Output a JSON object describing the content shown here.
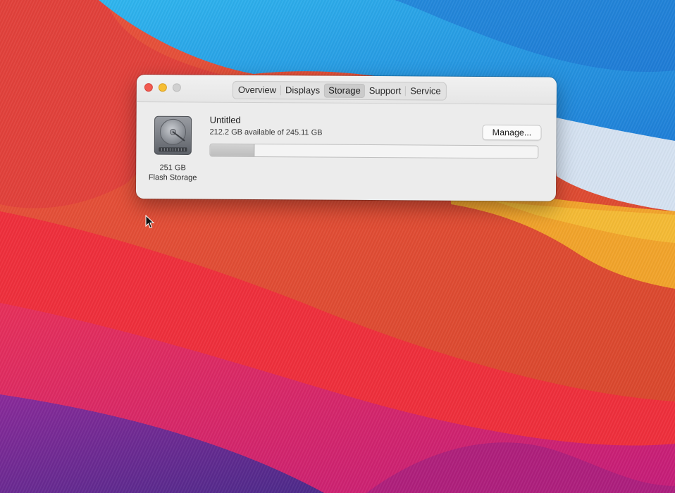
{
  "window": {
    "tabs": [
      {
        "label": "Overview",
        "active": false
      },
      {
        "label": "Displays",
        "active": false
      },
      {
        "label": "Storage",
        "active": true
      },
      {
        "label": "Support",
        "active": false
      },
      {
        "label": "Service",
        "active": false
      }
    ],
    "traffic_lights": {
      "close_color": "#f25a50",
      "minimize_color": "#f6be33",
      "zoom_color": "#d0d0d0"
    }
  },
  "disk": {
    "icon": "hard-drive-icon",
    "size_label": "251 GB",
    "type_label": "Flash Storage"
  },
  "volume": {
    "name": "Untitled",
    "available_text": "212.2 GB available of 245.11 GB",
    "used_fraction": 0.134
  },
  "actions": {
    "manage_label": "Manage..."
  },
  "desktop": {
    "wallpaper": "macOS Big Sur colorful waves",
    "cursor_icon": "arrow-pointer-icon"
  }
}
